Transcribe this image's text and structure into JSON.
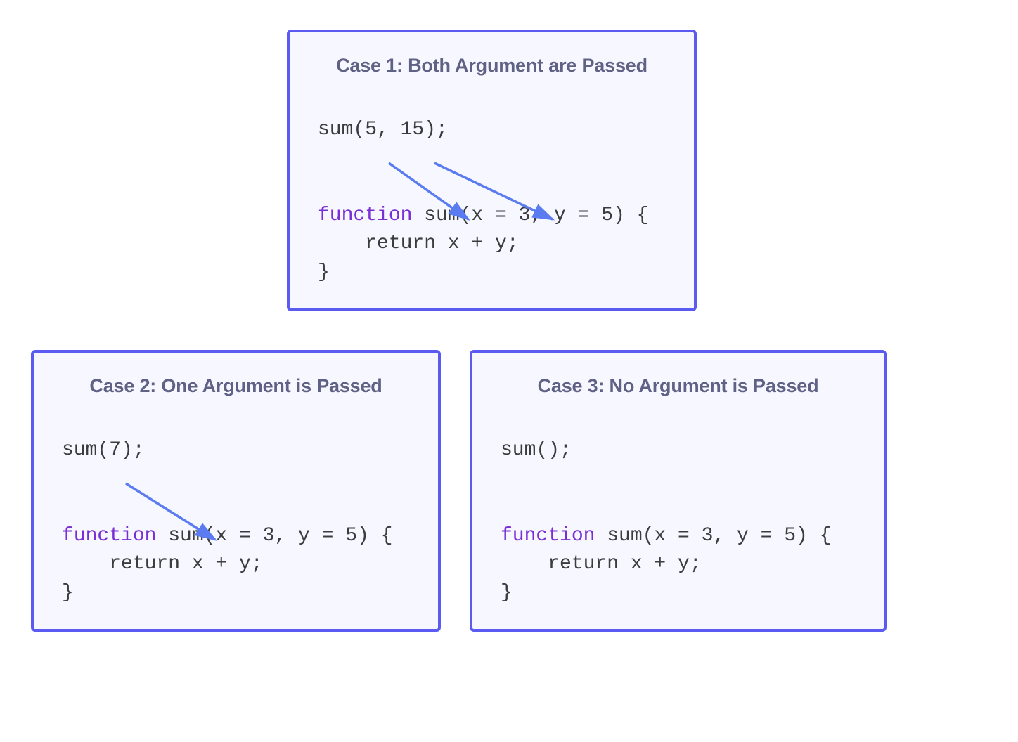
{
  "colors": {
    "border": "#5b5bf1",
    "card_bg": "#f7f8ff",
    "title": "#5f6185",
    "keyword": "#7a2ed6",
    "code": "#3b3c3d",
    "arrow": "#5a7cf0"
  },
  "cards": {
    "c1": {
      "title": "Case 1: Both Argument are Passed",
      "call": "sum(5, 15);",
      "fn_kw": "function",
      "fn_sig": " sum(x = 3, y = 5) {",
      "fn_body": "    return x + y;",
      "fn_close": "}"
    },
    "c2": {
      "title": "Case 2: One Argument is Passed",
      "call": "sum(7);",
      "fn_kw": "function",
      "fn_sig": " sum(x = 3, y = 5) {",
      "fn_body": "    return x + y;",
      "fn_close": "}"
    },
    "c3": {
      "title": "Case 3: No Argument is Passed",
      "call": "sum();",
      "fn_kw": "function",
      "fn_sig": " sum(x = 3, y = 5) {",
      "fn_body": "    return x + y;",
      "fn_close": "}"
    }
  }
}
